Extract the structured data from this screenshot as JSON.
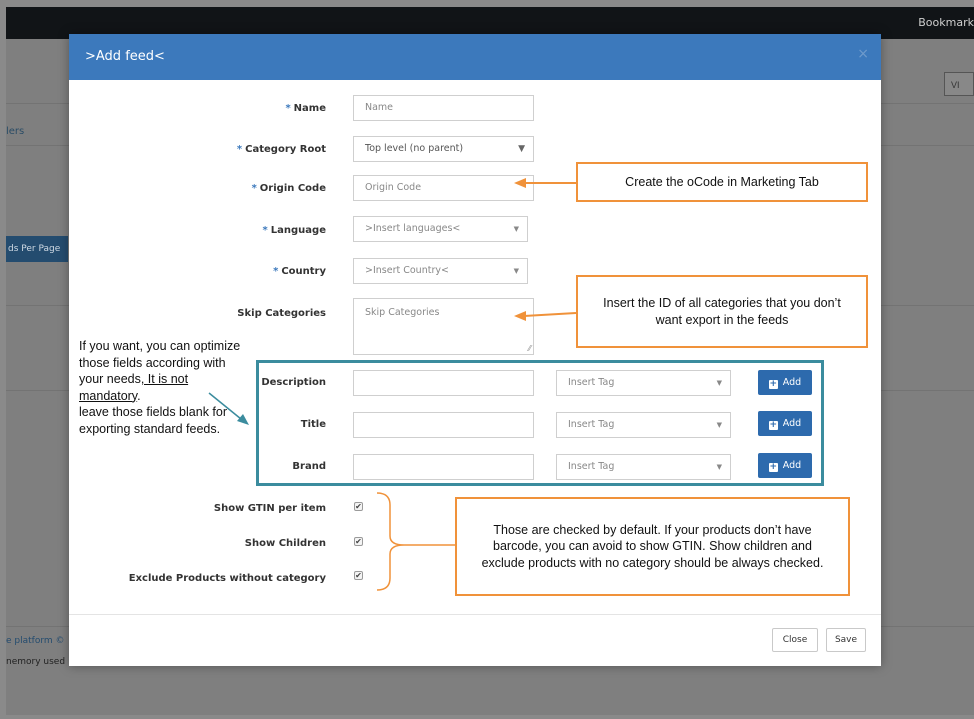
{
  "background": {
    "bookmark_label": "Bookmark",
    "sidebar_link": "lers",
    "per_page_button": "ds Per Page",
    "view_button": "VI",
    "footer_platform": "e platform ©",
    "footer_memory": "nemory used"
  },
  "modal": {
    "title": ">Add feed<",
    "close_icon": "×",
    "fields": {
      "name": {
        "label": "Name",
        "placeholder": "Name"
      },
      "category_root": {
        "label": "Category Root",
        "value": "Top level (no parent)"
      },
      "origin_code": {
        "label": "Origin Code",
        "placeholder": "Origin Code"
      },
      "language": {
        "label": "Language",
        "value": ">Insert languages<"
      },
      "country": {
        "label": "Country",
        "value": ">Insert Country<"
      },
      "skip_categories": {
        "label": "Skip Categories",
        "placeholder": "Skip Categories"
      },
      "description": {
        "label": "Description",
        "tag_placeholder": "Insert Tag",
        "add_label": "Add"
      },
      "title": {
        "label": "Title",
        "tag_placeholder": "Insert Tag",
        "add_label": "Add"
      },
      "brand": {
        "label": "Brand",
        "tag_placeholder": "Insert Tag",
        "add_label": "Add"
      }
    },
    "required_marker": "*",
    "checkboxes": {
      "show_gtin": {
        "label": "Show GTIN per item",
        "checked": true
      },
      "show_children": {
        "label": "Show Children",
        "checked": true
      },
      "exclude_no_category": {
        "label": "Exclude Products without category",
        "checked": true
      }
    },
    "footer": {
      "close_label": "Close",
      "save_label": "Save"
    }
  },
  "annotations": {
    "origin_code_note": "Create the oCode in Marketing Tab",
    "skip_categories_note": "Insert the ID of all categories that you don’t want export in the feeds",
    "optional_fields_note": {
      "line1": "If you want, you can optimize those fields according with your needs",
      "underlined": ", It is not mandatory",
      "line2": ".",
      "line3": "leave those fields blank for exporting standard feeds."
    },
    "checkbox_note": "Those are checked by default. If your products don’t have barcode, you can avoid to show GTIN. Show children and exclude products with no category should be always checked."
  },
  "colors": {
    "modal_header": "#3c79bc",
    "add_button": "#2d6aad",
    "annotation_border": "#f0923a",
    "group_border": "#3b8c9e"
  },
  "icons": {
    "select_caret": "▼",
    "checkmark": "✔",
    "plus": "+"
  }
}
